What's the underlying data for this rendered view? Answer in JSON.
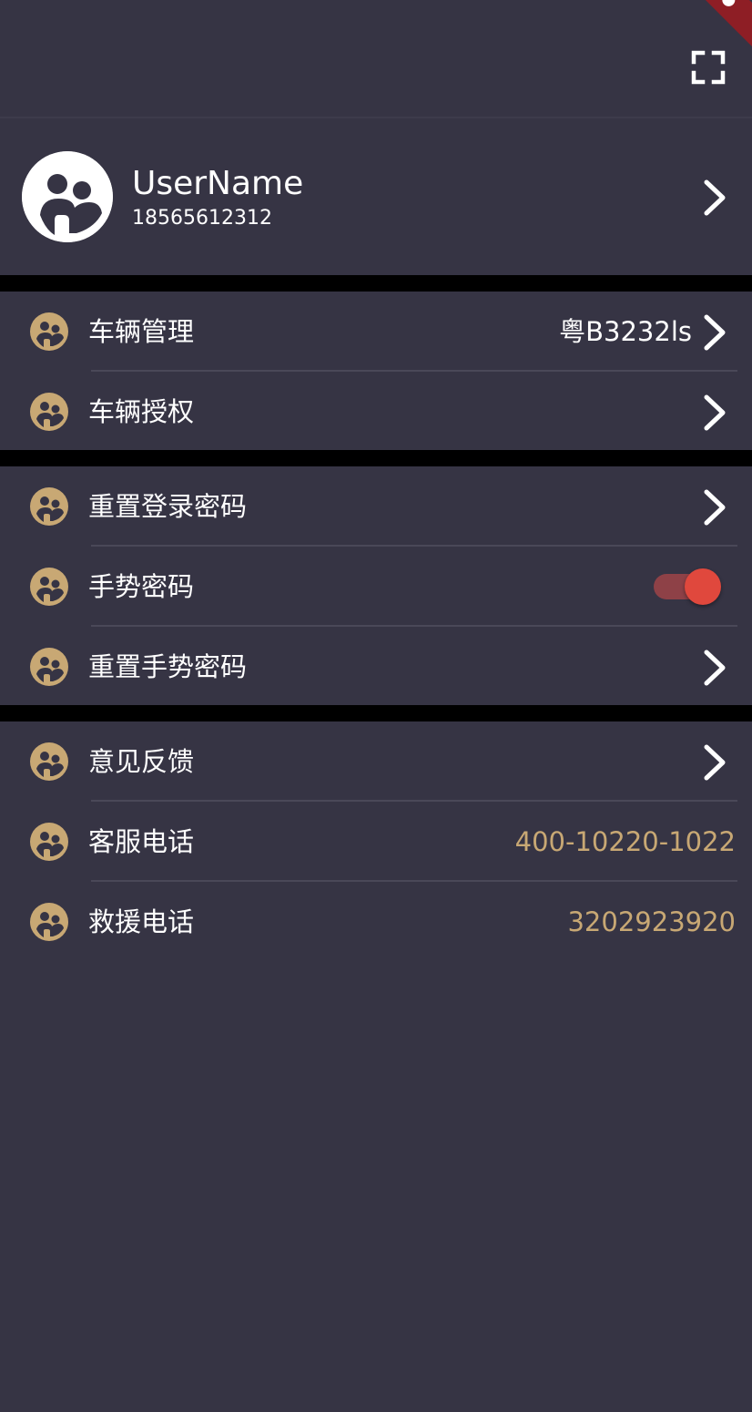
{
  "colors": {
    "background": "#363444",
    "separator": "#000000",
    "accent_gold": "#c8a874",
    "toggle_on": "#e0483d",
    "text": "#ffffff"
  },
  "appbar": {
    "action_icon": "scan-frame-icon"
  },
  "profile": {
    "username": "UserName",
    "phone": "18565612312",
    "avatar_icon": "user-avatar-icon"
  },
  "groups": [
    {
      "items": [
        {
          "label": "车辆管理",
          "value": "粤B3232ls",
          "icon": "face-icon",
          "trailing": "chevron"
        },
        {
          "label": "车辆授权",
          "icon": "face-icon",
          "trailing": "chevron"
        }
      ]
    },
    {
      "items": [
        {
          "label": "重置登录密码",
          "icon": "face-icon",
          "trailing": "chevron"
        },
        {
          "label": "手势密码",
          "icon": "face-icon",
          "trailing": "toggle",
          "toggle_on": true
        },
        {
          "label": "重置手势密码",
          "icon": "face-icon",
          "trailing": "chevron"
        }
      ]
    },
    {
      "items": [
        {
          "label": "意见反馈",
          "icon": "face-icon",
          "trailing": "chevron"
        },
        {
          "label": "客服电话",
          "value": "400-10220-1022",
          "icon": "face-icon",
          "trailing": "value"
        },
        {
          "label": "救援电话",
          "value": "3202923920",
          "icon": "face-icon",
          "trailing": "value"
        }
      ]
    }
  ]
}
